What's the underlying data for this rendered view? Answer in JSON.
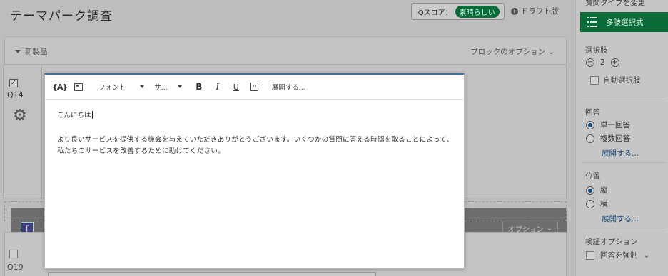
{
  "page": {
    "title": "テーマパーク調査"
  },
  "iq_score": {
    "label": "iQスコア：",
    "value": "素晴らしい"
  },
  "draft": {
    "label": "ドラフト版"
  },
  "block": {
    "name": "新製品",
    "options_label": "ブロックのオプション"
  },
  "question14": {
    "label": "Q14",
    "checked": true,
    "options_label": "オプション"
  },
  "question19": {
    "label": "Q19"
  },
  "sidebar": {
    "question_type_title": "質問タイプを変更",
    "question_type_value": "多肢選択式",
    "choices_label": "選択肢",
    "choices_count": "2",
    "auto_choices_label": "自動選択肢",
    "answers_label": "回答",
    "answers": [
      {
        "label": "単一回答",
        "selected": true
      },
      {
        "label": "複数回答",
        "selected": false
      }
    ],
    "answers_expand": "展開する...",
    "position_label": "位置",
    "positions": [
      {
        "label": "縦",
        "selected": true
      },
      {
        "label": "横",
        "selected": false
      }
    ],
    "position_expand": "展開する...",
    "validation_label": "検証オプション",
    "force_response_label": "回答を強制"
  },
  "editor": {
    "toolbar": {
      "font_label": "フォント",
      "size_label": "サ...",
      "expand_label": "展開する..."
    },
    "greeting": "こんにちは",
    "body": "より良いサービスを提供する機会を与えていただきありがとうございます。いくつかの質問に答える時間を取ることによって、私たちのサービスを改善するために助けてください。"
  },
  "colors": {
    "accent_green": "#0b6b38",
    "focus_blue": "#3a6fb5",
    "link_blue": "#1d4c78"
  }
}
